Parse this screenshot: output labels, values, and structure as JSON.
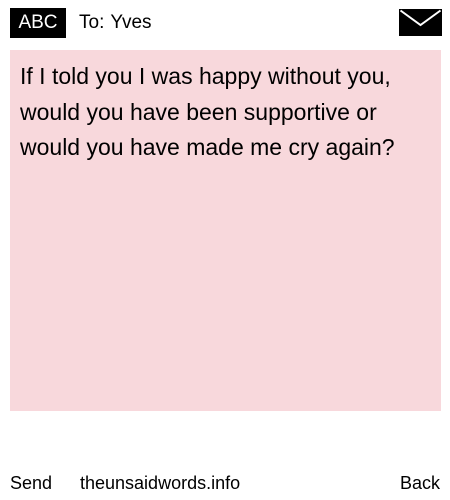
{
  "header": {
    "mode_badge": "ABC",
    "recipient_prefix": "To:",
    "recipient_name": "Yves",
    "icon": "envelope-icon"
  },
  "message": {
    "text": "If I told you I was happy without you, would you have been supportive or would you have made me cry again?",
    "background_color": "#f8d8dc"
  },
  "footer": {
    "left_softkey": "Send",
    "site": "theunsaidwords.info",
    "right_softkey": "Back"
  },
  "colors": {
    "badge_background": "#000000",
    "badge_text": "#ffffff",
    "page_background": "#ffffff",
    "text": "#000000"
  }
}
